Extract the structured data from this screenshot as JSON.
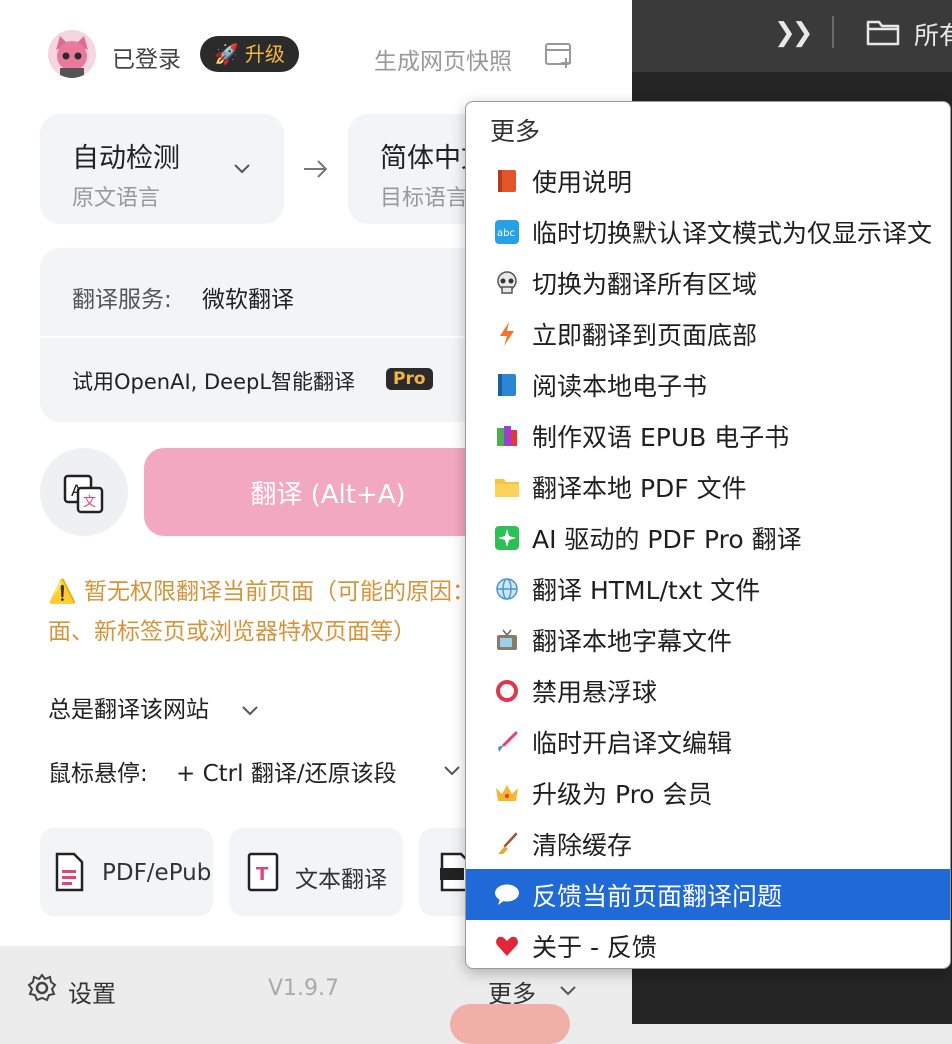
{
  "header": {
    "status": "已登录",
    "upgrade_label": "升级",
    "snapshot_label": "生成网页快照"
  },
  "lang": {
    "source_main": "自动检测",
    "source_sub": "原文语言",
    "target_main": "简体中文",
    "target_sub": "目标语言"
  },
  "service": {
    "label": "翻译服务:",
    "value": "微软翻译",
    "try_text": "试用OpenAI, DeepL智能翻译",
    "pro_badge": "Pro"
  },
  "translate_button": "翻译 (Alt+A)",
  "warning": "⚠️ 暂无权限翻译当前页面（可能的原因：扩展商店页面、新标签页或浏览器特权页面等）",
  "options": {
    "always_label": "总是翻译该网站",
    "hover_label": "鼠标悬停:",
    "hover_value": "+ Ctrl 翻译/还原该段"
  },
  "tools": [
    {
      "label": "PDF/ePub"
    },
    {
      "label": "文本翻译"
    }
  ],
  "footer": {
    "settings_label": "设置",
    "version": "V1.9.7",
    "more_label": "更多"
  },
  "background_window": {
    "label": "所有"
  },
  "menu": {
    "header": "更多",
    "items": [
      {
        "label": "使用说明",
        "icon": "red-book-icon"
      },
      {
        "label": "临时切换默认译文模式为仅显示译文",
        "icon": "abc-icon"
      },
      {
        "label": "切换为翻译所有区域",
        "icon": "skull-icon"
      },
      {
        "label": "立即翻译到页面底部",
        "icon": "lightning-icon"
      },
      {
        "label": "阅读本地电子书",
        "icon": "blue-book-icon"
      },
      {
        "label": "制作双语 EPUB 电子书",
        "icon": "books-icon"
      },
      {
        "label": "翻译本地 PDF 文件",
        "icon": "folder-icon"
      },
      {
        "label": "AI 驱动的 PDF Pro 翻译",
        "icon": "sparkle-icon"
      },
      {
        "label": "翻译 HTML/txt 文件",
        "icon": "globe-icon"
      },
      {
        "label": "翻译本地字幕文件",
        "icon": "tv-icon"
      },
      {
        "label": "禁用悬浮球",
        "icon": "circle-icon"
      },
      {
        "label": "临时开启译文编辑",
        "icon": "brush-icon"
      },
      {
        "label": "升级为 Pro 会员",
        "icon": "crown-icon"
      },
      {
        "label": "清除缓存",
        "icon": "broom-icon"
      },
      {
        "label": "反馈当前页面翻译问题",
        "icon": "speech-bubble-icon"
      },
      {
        "label": "关于 - 反馈",
        "icon": "heart-icon"
      }
    ],
    "active_index": 14
  },
  "colors": {
    "accent_pink": "#f2a8c0",
    "menu_highlight": "#1f6ad6",
    "warning": "#d4953a",
    "pro_gold": "#f3b642"
  }
}
